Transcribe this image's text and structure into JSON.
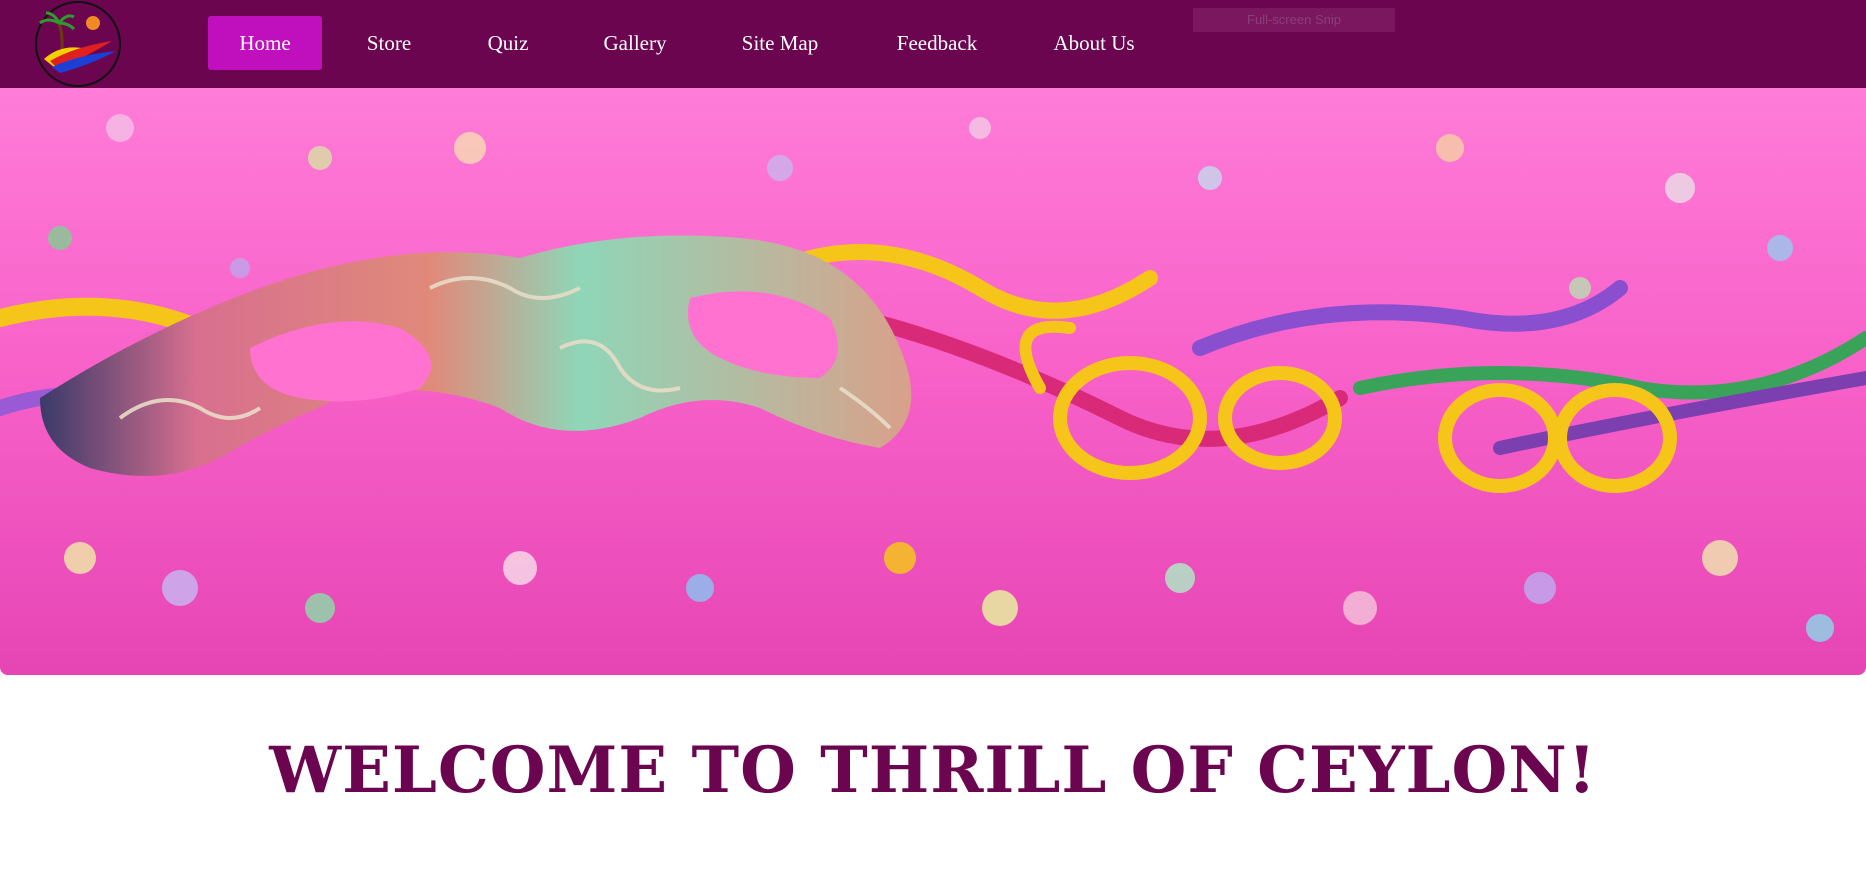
{
  "header": {
    "logo_icon": "palm-sun-wave-logo-icon",
    "nav": [
      {
        "label": "Home",
        "active": true
      },
      {
        "label": "Store",
        "active": false
      },
      {
        "label": "Quiz",
        "active": false
      },
      {
        "label": "Gallery",
        "active": false
      },
      {
        "label": "Site Map",
        "active": false
      },
      {
        "label": "Feedback",
        "active": false
      },
      {
        "label": "About Us",
        "active": false
      }
    ],
    "overlay_tag": "Full-screen Snip"
  },
  "hero": {
    "image": "carnival mask with confetti and streamers on pink background"
  },
  "main": {
    "heading": "WELCOME TO THRILL OF CEYLON!"
  },
  "colors": {
    "navbar_bg": "#6b0550",
    "nav_active_bg": "#c00fbd",
    "heading": "#6b0550",
    "hero_bg": "#ff6fd2"
  }
}
